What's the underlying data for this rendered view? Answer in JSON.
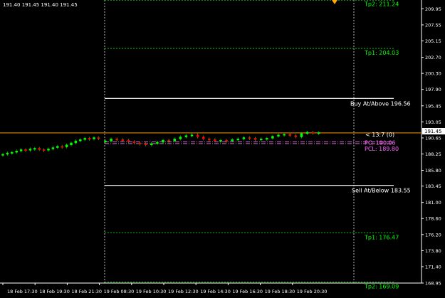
{
  "ohlc_readout": "191.40 191.45 191.40 191.45",
  "colors": {
    "background": "#000000",
    "axis": "#ffffff",
    "grid": "#ffffff",
    "tp_line": "#00c000",
    "tp_text": "#00ff00",
    "entry_line": "#ffffff",
    "price_line": "#ff9900",
    "pivot_line": "#cc66cc",
    "pivot_text": "#ff66ff",
    "candle_up": "#00ff00",
    "candle_down": "#ff0000",
    "wick": "#00cc00"
  },
  "price_axis": {
    "min": 168.95,
    "max": 210.95,
    "ticks": [
      "209.95",
      "207.55",
      "205.15",
      "202.70",
      "200.30",
      "197.90",
      "195.45",
      "193.05",
      "190.65",
      "188.25",
      "185.80",
      "183.45",
      "181.00",
      "178.60",
      "176.20",
      "173.80",
      "171.40",
      "168.95"
    ],
    "current_price": "191.45"
  },
  "time_axis": {
    "labels": [
      "18 Feb 17:30",
      "18 Feb 19:30",
      "18 Feb 21:30",
      "19 Feb 08:30",
      "19 Feb 10:30",
      "19 Feb 12:30",
      "19 Feb 14:30",
      "19 Feb 16:30",
      "19 Feb 18:30",
      "19 Feb 20:30"
    ]
  },
  "levels": [
    {
      "label": "Tp2: 211.24",
      "price": 211.24,
      "kind": "tp"
    },
    {
      "label": "Tp1: 204.03",
      "price": 204.03,
      "kind": "tp"
    },
    {
      "label": "Buy At/Above 196.56",
      "price": 196.56,
      "kind": "entry"
    },
    {
      "label": "PC: 190.06",
      "price": 190.06,
      "kind": "pivot"
    },
    {
      "label": "PCL: 189.80",
      "price": 189.8,
      "kind": "pivot"
    },
    {
      "label": "Sell At/Below 183.55",
      "price": 183.55,
      "kind": "entry"
    },
    {
      "label": "Tp1: 176.47",
      "price": 176.47,
      "kind": "tp"
    },
    {
      "label": "Tp2: 169.09",
      "price": 169.09,
      "kind": "tp"
    }
  ],
  "countdown": "< 13:7 (0)",
  "candles": {
    "section1": [
      188.2,
      188.4,
      188.5,
      188.7,
      188.9,
      188.8,
      189.0,
      189.1,
      188.9,
      188.8,
      189.0,
      189.2,
      189.4,
      189.3,
      189.6,
      189.9,
      190.2,
      190.4,
      190.6,
      190.5,
      190.7,
      190.6
    ],
    "section2": [
      190.2,
      190.5,
      190.4,
      190.3,
      190.1,
      189.9,
      189.8,
      189.6,
      189.8,
      190.0,
      190.3,
      190.2,
      190.5,
      190.8,
      191.0,
      191.1,
      190.8,
      190.5,
      190.4,
      190.2,
      190.3,
      190.2,
      190.4,
      190.5,
      190.7,
      190.6,
      190.4,
      190.5,
      190.6,
      190.9,
      191.1,
      191.2,
      191.0,
      190.8,
      191.3,
      191.5,
      191.4,
      191.45
    ]
  }
}
